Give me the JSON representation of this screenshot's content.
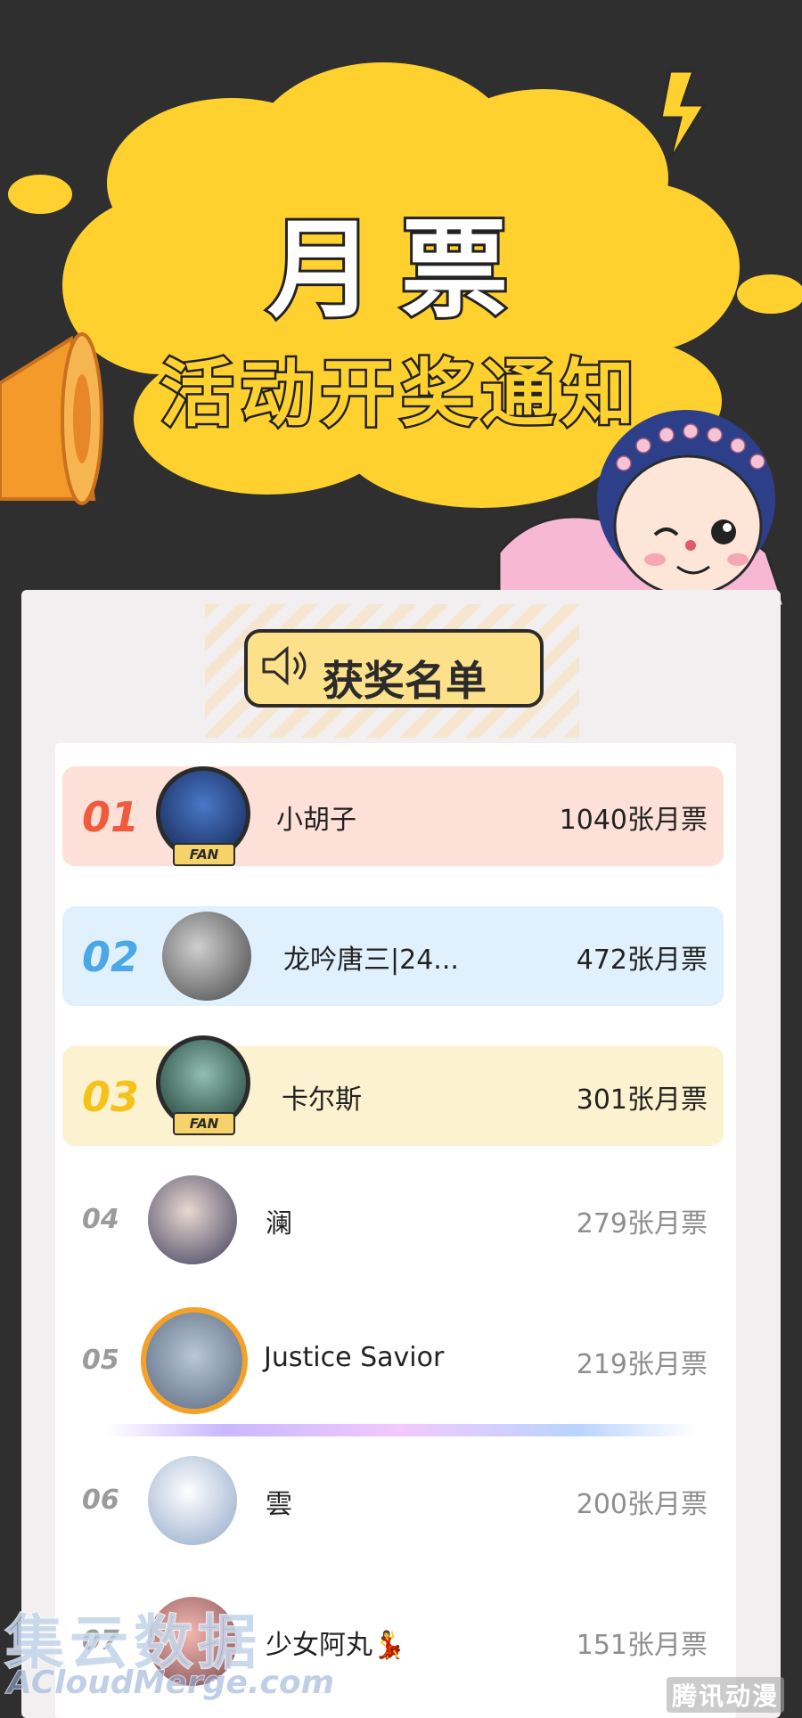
{
  "banner": {
    "title": "月票",
    "subtitle": "活动开奖通知"
  },
  "list": {
    "title": "获奖名单",
    "entries": [
      {
        "rank": "01",
        "name": "小胡子",
        "votes": "1040张月票",
        "rank_color": "#ef5b3c"
      },
      {
        "rank": "02",
        "name": "龙吟唐三|24...",
        "votes": "472张月票",
        "rank_color": "#4aa8e8"
      },
      {
        "rank": "03",
        "name": "卡尔斯",
        "votes": "301张月票",
        "rank_color": "#f4c21a"
      },
      {
        "rank": "04",
        "name": "澜",
        "votes": "279张月票"
      },
      {
        "rank": "05",
        "name": "Justice Savior",
        "votes": "219张月票"
      },
      {
        "rank": "06",
        "name": "雲",
        "votes": "200张月票"
      },
      {
        "rank": "07",
        "name": "少女阿丸💃",
        "votes": "151张月票"
      }
    ]
  },
  "badges": {
    "fan": "FAN"
  },
  "watermarks": {
    "left_main": "集云数据",
    "left_sub": "ACloudMerge.com",
    "right": "腾讯动漫"
  },
  "colors": {
    "background": "#2f2f2f",
    "cloud": "#ffd12e",
    "row1": "#fde0d8",
    "row2": "#e1f0fd",
    "row3": "#fdf2cf"
  }
}
